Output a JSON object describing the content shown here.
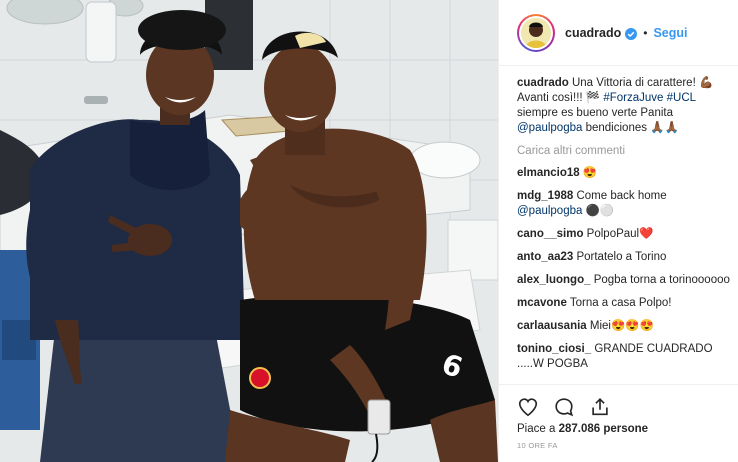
{
  "post": {
    "username": "cuadrado",
    "separator": "•",
    "follow_label": "Segui"
  },
  "caption": {
    "username": "cuadrado",
    "text_1": "Una Vittoria di carattere! 💪🏾 Avanti così!!! 🏁 ",
    "hashtag_1": "#ForzaJuve",
    "space_1": " ",
    "hashtag_2": "#UCL",
    "text_2": " siempre es bueno verte Panita ",
    "mention": "@paulpogba",
    "text_3": " bendiciones 🙏🏾🙏🏾"
  },
  "load_more_label": "Carica altri commenti",
  "comments": [
    {
      "user": "elmancio18",
      "text": " 😍"
    },
    {
      "user": "mdg_1988",
      "text": " Come back home ",
      "mention": "@paulpogba",
      "suffix": " ⚫⚪"
    },
    {
      "user": "cano__simo",
      "text": " PolpoPaul❤️"
    },
    {
      "user": "anto_aa23",
      "text": " Portatelo a Torino"
    },
    {
      "user": "alex_luongo_",
      "text": " Pogba torna a torinoooooo"
    },
    {
      "user": "mcavone",
      "text": " Torna a casa Polpo!"
    },
    {
      "user": "carlaausania",
      "text": " Miei😍😍😍"
    },
    {
      "user": "tonino_ciosi_",
      "text": " GRANDE CUADRADO .....W POGBA"
    }
  ],
  "likes": {
    "prefix": "Piace a ",
    "count": "287.086",
    "suffix": " persone"
  },
  "timestamp": "10 ORE FA",
  "icons": {
    "like": "heart-icon",
    "comment": "comment-bubble-icon",
    "share": "share-icon",
    "verified": "verified-badge-icon"
  },
  "colors": {
    "link": "#003569",
    "follow": "#3897f0",
    "verified": "#3897f0",
    "muted": "#999999"
  }
}
